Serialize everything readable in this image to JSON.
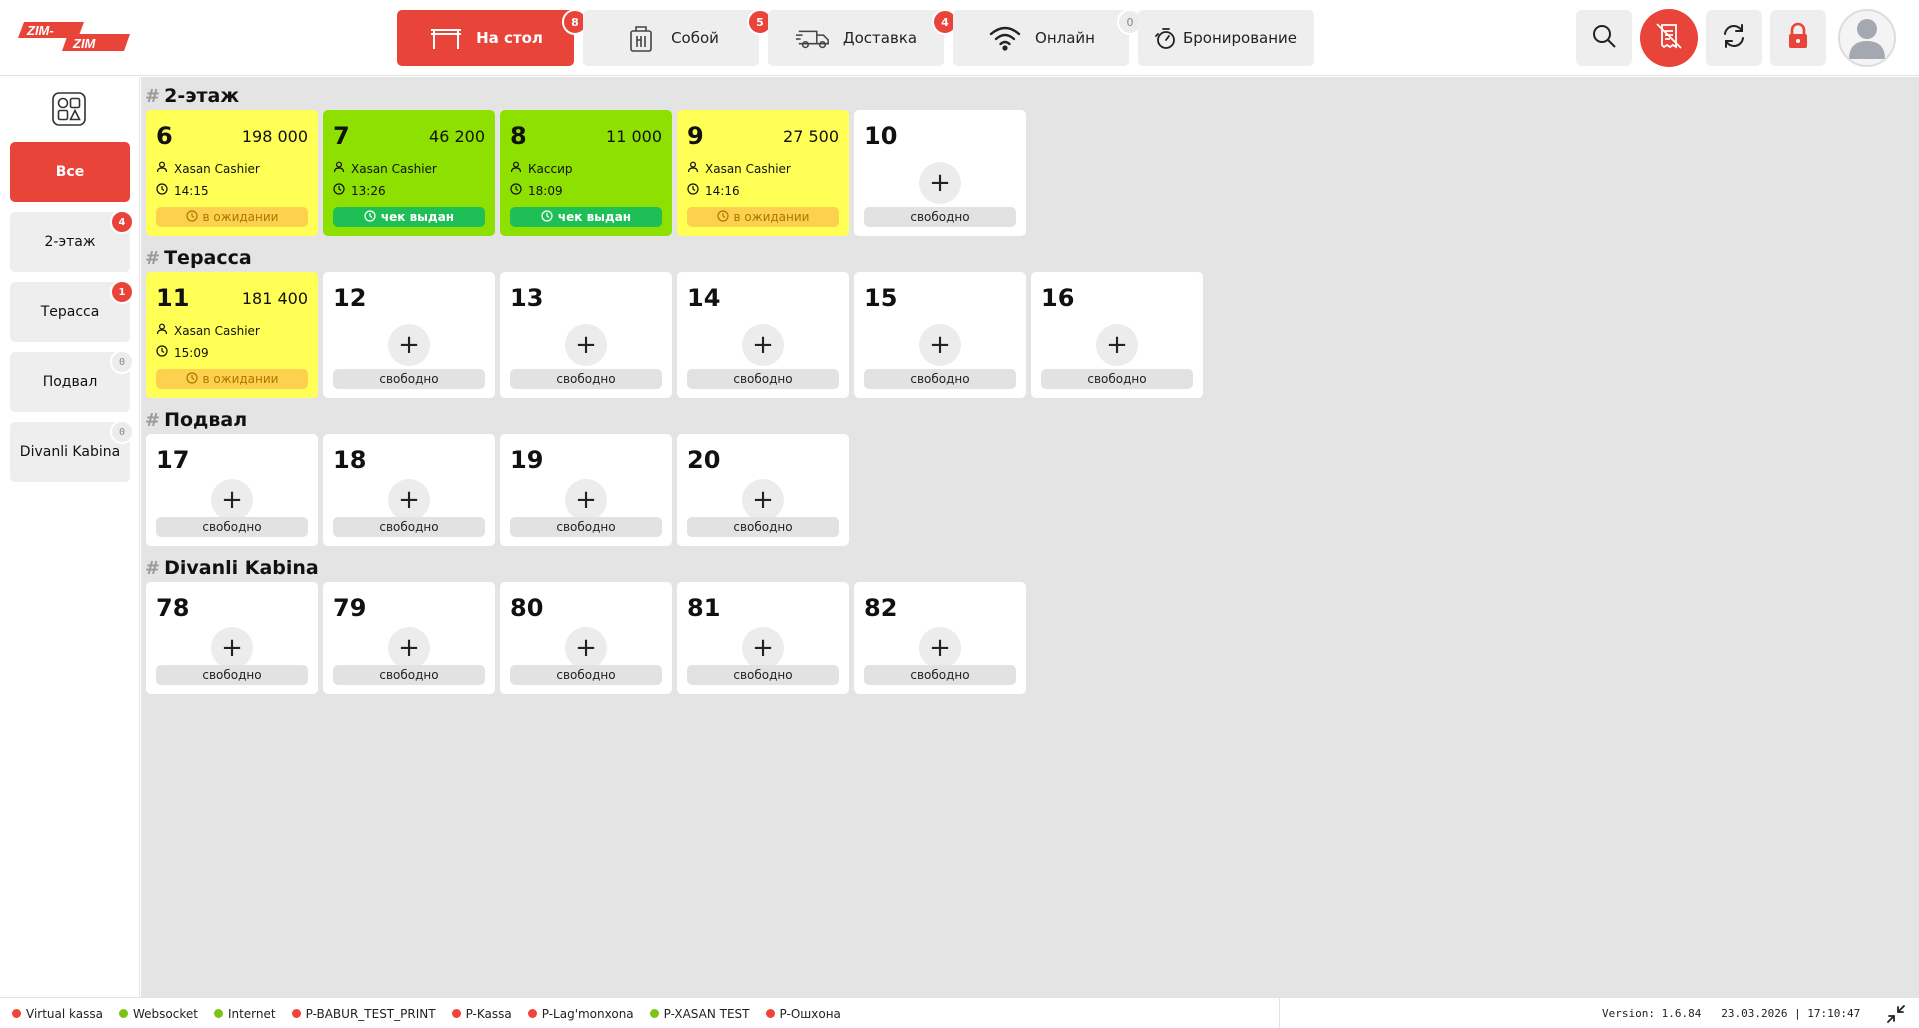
{
  "app": {
    "logo_text": "ZIM-ZIM"
  },
  "tabs": [
    {
      "label": "На стол",
      "badge": "8",
      "active": true,
      "icon": "table-icon"
    },
    {
      "label": "Собой",
      "badge": "5",
      "active": false,
      "icon": "takeaway-bag-icon"
    },
    {
      "label": "Доставка",
      "badge": "4",
      "active": false,
      "icon": "delivery-truck-icon"
    },
    {
      "label": "Онлайн",
      "badge": "0",
      "active": false,
      "icon": "wifi-icon"
    },
    {
      "label": "Бронирование",
      "badge": "",
      "active": false,
      "icon": "timer-icon"
    }
  ],
  "actions": [
    "search-icon",
    "receipt-off-icon",
    "refresh-icon",
    "lock-icon",
    "user-avatar-icon"
  ],
  "sidebar": {
    "items": [
      {
        "label": "Все",
        "badge": "",
        "active": true
      },
      {
        "label": "2-этаж",
        "badge": "4",
        "active": false
      },
      {
        "label": "Терасса",
        "badge": "1",
        "active": false
      },
      {
        "label": "Подвал",
        "badge": "0",
        "active": false
      },
      {
        "label": "Divanli Kabina",
        "badge": "0",
        "active": false
      }
    ]
  },
  "sections": [
    {
      "title": "2-этаж",
      "tables": [
        {
          "number": "6",
          "amount": "198 000",
          "waiter": "Xasan Cashier",
          "time": "14:15",
          "status": "в ожидании",
          "state": "waiting"
        },
        {
          "number": "7",
          "amount": "46 200",
          "waiter": "Xasan Cashier",
          "time": "13:26",
          "status": "чек выдан",
          "state": "issued"
        },
        {
          "number": "8",
          "amount": "11 000",
          "waiter": "Кассир",
          "time": "18:09",
          "status": "чек выдан",
          "state": "issued"
        },
        {
          "number": "9",
          "amount": "27 500",
          "waiter": "Xasan Cashier",
          "time": "14:16",
          "status": "в ожидании",
          "state": "waiting"
        },
        {
          "number": "10",
          "status": "свободно",
          "state": "free"
        }
      ]
    },
    {
      "title": "Терасса",
      "tables": [
        {
          "number": "11",
          "amount": "181 400",
          "waiter": "Xasan Cashier",
          "time": "15:09",
          "status": "в ожидании",
          "state": "waiting"
        },
        {
          "number": "12",
          "status": "свободно",
          "state": "free"
        },
        {
          "number": "13",
          "status": "свободно",
          "state": "free"
        },
        {
          "number": "14",
          "status": "свободно",
          "state": "free"
        },
        {
          "number": "15",
          "status": "свободно",
          "state": "free"
        },
        {
          "number": "16",
          "status": "свободно",
          "state": "free"
        }
      ]
    },
    {
      "title": "Подвал",
      "tables": [
        {
          "number": "17",
          "status": "свободно",
          "state": "free"
        },
        {
          "number": "18",
          "status": "свободно",
          "state": "free"
        },
        {
          "number": "19",
          "status": "свободно",
          "state": "free"
        },
        {
          "number": "20",
          "status": "свободно",
          "state": "free"
        }
      ]
    },
    {
      "title": "Divanli Kabina",
      "tables": [
        {
          "number": "78",
          "status": "свободно",
          "state": "free"
        },
        {
          "number": "79",
          "status": "свободно",
          "state": "free"
        },
        {
          "number": "80",
          "status": "свободно",
          "state": "free"
        },
        {
          "number": "81",
          "status": "свободно",
          "state": "free"
        },
        {
          "number": "82",
          "status": "свободно",
          "state": "free"
        }
      ]
    }
  ],
  "footer": {
    "services": [
      {
        "label": "Virtual kassa",
        "ok": false
      },
      {
        "label": "Websocket",
        "ok": true
      },
      {
        "label": "Internet",
        "ok": true
      },
      {
        "label": "P-BABUR_TEST_PRINT",
        "ok": false
      },
      {
        "label": "P-Kassa",
        "ok": false
      },
      {
        "label": "P-Lag'monxona",
        "ok": false
      },
      {
        "label": "P-XASAN TEST",
        "ok": true
      },
      {
        "label": "P-Ошхона",
        "ok": false
      }
    ],
    "version": "Version: 1.6.84",
    "datetime": "23.03.2026 | 17:10:47"
  },
  "colors": {
    "accent": "#e8443a",
    "waiting": "#ffff55",
    "issued": "#8ee000",
    "free": "#ffffff"
  }
}
